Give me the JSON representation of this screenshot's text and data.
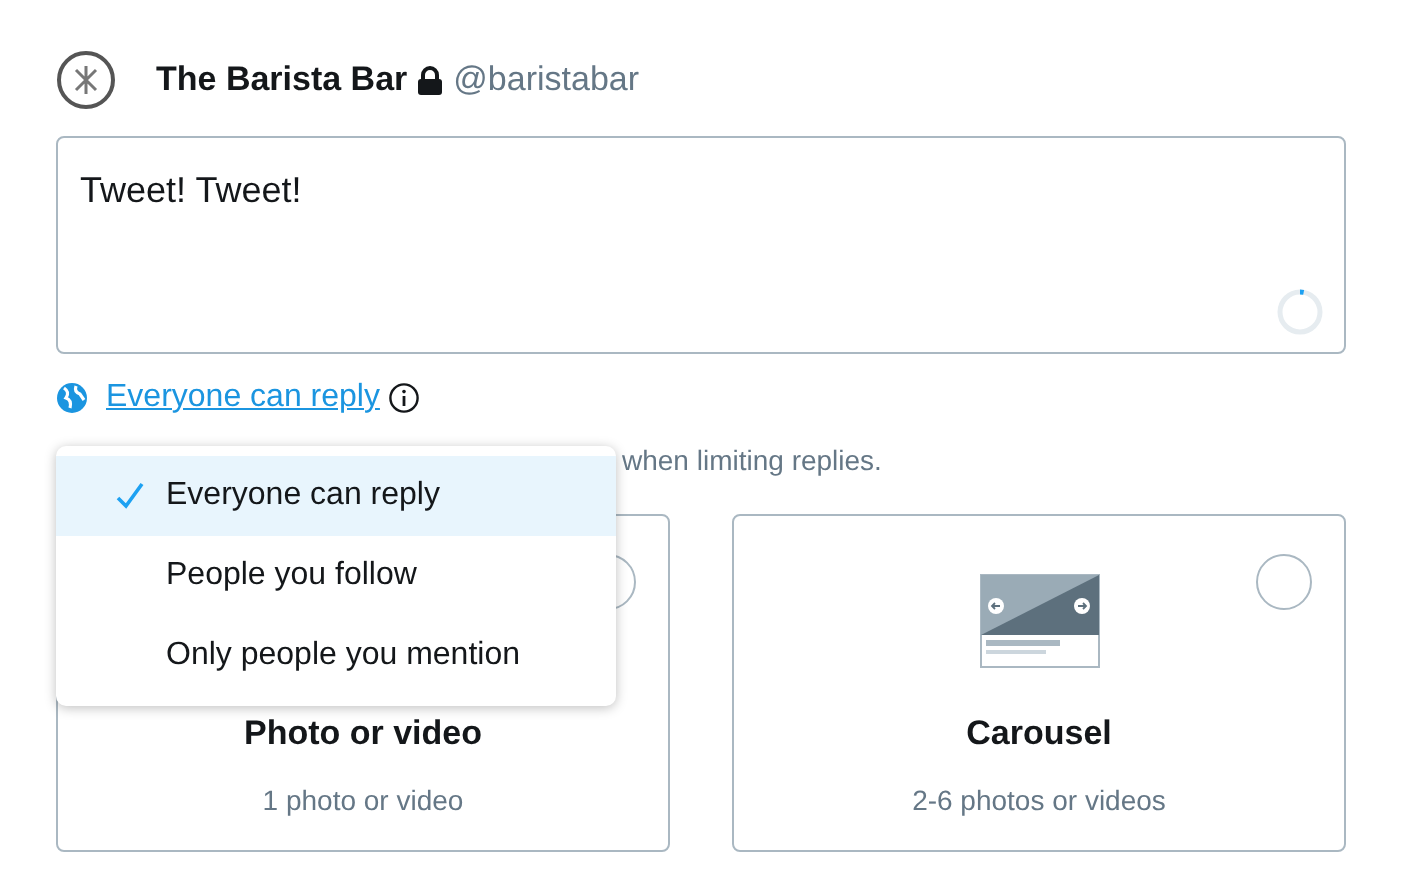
{
  "account": {
    "name": "The Barista Bar",
    "handle": "@baristabar",
    "protected": true
  },
  "composer": {
    "value": "Tweet! Tweet!",
    "counter": {
      "level": 0.03
    }
  },
  "reply_setting": {
    "label": "Everyone can reply"
  },
  "helper_text": "when limiting replies.",
  "reply_menu": [
    {
      "label": "Everyone can reply",
      "selected": true
    },
    {
      "label": "People you follow",
      "selected": false
    },
    {
      "label": "Only people you mention",
      "selected": false
    }
  ],
  "media_options": [
    {
      "kind": "single",
      "title": "Photo or video",
      "subtitle": "1 photo or video",
      "selected": false
    },
    {
      "kind": "carousel",
      "title": "Carousel",
      "subtitle": "2-6 photos or videos",
      "selected": false
    }
  ]
}
